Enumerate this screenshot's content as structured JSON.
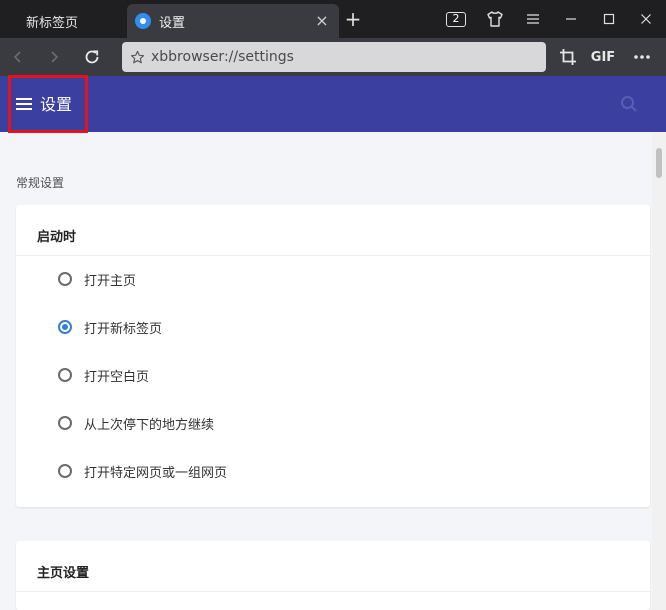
{
  "tabs": [
    {
      "label": "新标签页",
      "active": false
    },
    {
      "label": "设置",
      "active": true
    }
  ],
  "tab_strip": {
    "tab_count": "2"
  },
  "toolbar": {
    "url": "xbbrowser://settings",
    "gif_label": "GIF"
  },
  "header": {
    "title": "设置"
  },
  "content": {
    "section_label": "常规设置",
    "startup_card": {
      "title": "启动时",
      "options": [
        {
          "label": "打开主页",
          "checked": false
        },
        {
          "label": "打开新标签页",
          "checked": true
        },
        {
          "label": "打开空白页",
          "checked": false
        },
        {
          "label": "从上次停下的地方继续",
          "checked": false
        },
        {
          "label": "打开特定网页或一组网页",
          "checked": false
        }
      ]
    },
    "homepage_card": {
      "title": "主页设置"
    }
  },
  "colors": {
    "accent": "#3b3fa0",
    "radio_checked": "#2e7fd9",
    "highlight": "#e3141c"
  }
}
